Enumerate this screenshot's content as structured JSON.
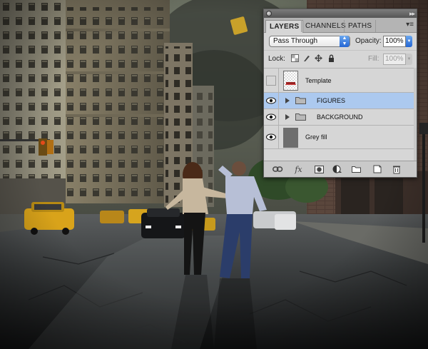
{
  "panel": {
    "tabs": [
      "LAYERS",
      "CHANNELS",
      "PATHS"
    ],
    "menu_icon": "panel-menu-icon",
    "blend_mode": "Pass Through",
    "opacity_label": "Opacity:",
    "opacity_value": "100%",
    "lock_label": "Lock:",
    "fill_label": "Fill:",
    "fill_value": "100%",
    "layers": [
      {
        "name": "Template",
        "type": "layer",
        "visible": false,
        "selected": false
      },
      {
        "name": "FIGURES",
        "type": "group",
        "visible": true,
        "selected": true
      },
      {
        "name": "BACKGROUND",
        "type": "group",
        "visible": true,
        "selected": false
      },
      {
        "name": "Grey fill",
        "type": "layer",
        "visible": true,
        "selected": false
      }
    ],
    "footer_icons": [
      "link-layers-icon",
      "layer-style-fx-icon",
      "layer-mask-icon",
      "adjustment-layer-icon",
      "new-group-icon",
      "new-layer-icon",
      "delete-layer-icon"
    ],
    "fx_label": "fx",
    "selection_color": "#acc9ef"
  }
}
